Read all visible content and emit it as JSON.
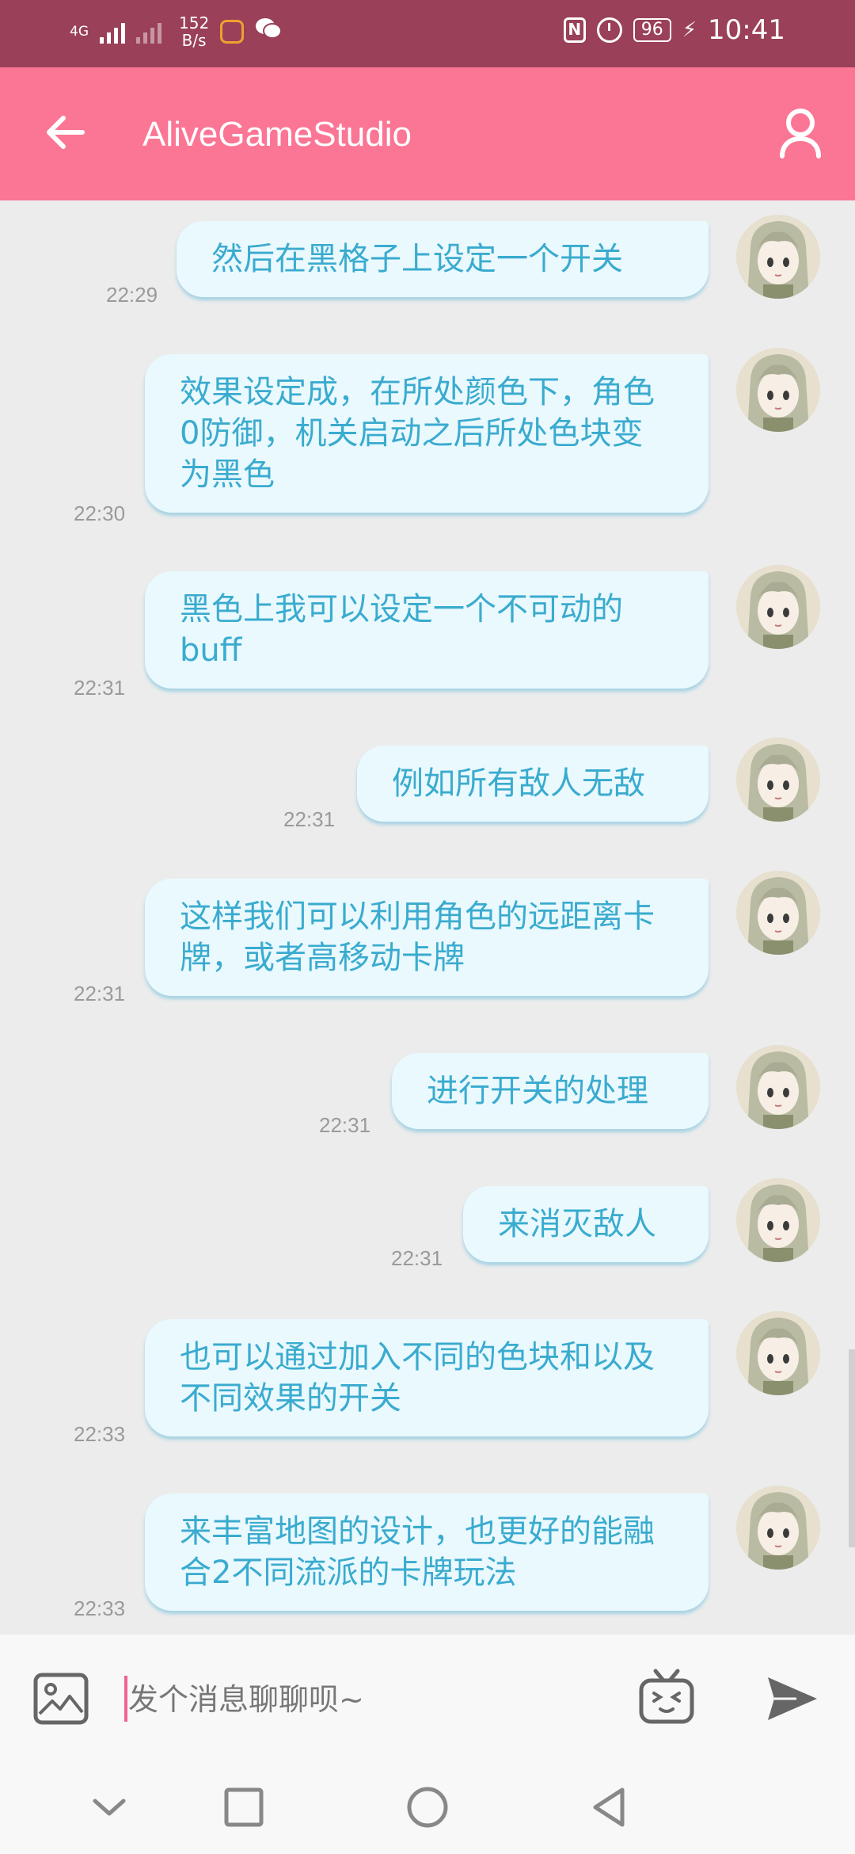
{
  "status_bar": {
    "network": "4G",
    "speed_value": "152",
    "speed_unit": "B/s",
    "battery": "96",
    "time": "10:41"
  },
  "app_bar": {
    "title": "AliveGameStudio"
  },
  "messages": [
    {
      "text": "然后在黑格子上设定一个开关",
      "time": "22:29"
    },
    {
      "text": "效果设定成，在所处颜色下，角色0防御，机关启动之后所处色块变为黑色",
      "time": "22:30"
    },
    {
      "text": "黑色上我可以设定一个不可动的buff",
      "time": "22:31"
    },
    {
      "text": "例如所有敌人无敌",
      "time": "22:31"
    },
    {
      "text": "这样我们可以利用角色的远距离卡牌，或者高移动卡牌",
      "time": "22:31"
    },
    {
      "text": "进行开关的处理",
      "time": "22:31"
    },
    {
      "text": "来消灭敌人",
      "time": "22:31"
    },
    {
      "text": "也可以通过加入不同的色块和以及不同效果的开关",
      "time": "22:33"
    },
    {
      "text": "来丰富地图的设计，也更好的能融合2不同流派的卡牌玩法",
      "time": "22:33"
    }
  ],
  "input": {
    "placeholder": "发个消息聊聊呗~"
  },
  "colors": {
    "status_bar": "#9a4058",
    "app_bar": "#fb7594",
    "bubble_bg": "#eaf9fe",
    "bubble_text": "#3aabcf",
    "chat_bg": "#ececec"
  }
}
